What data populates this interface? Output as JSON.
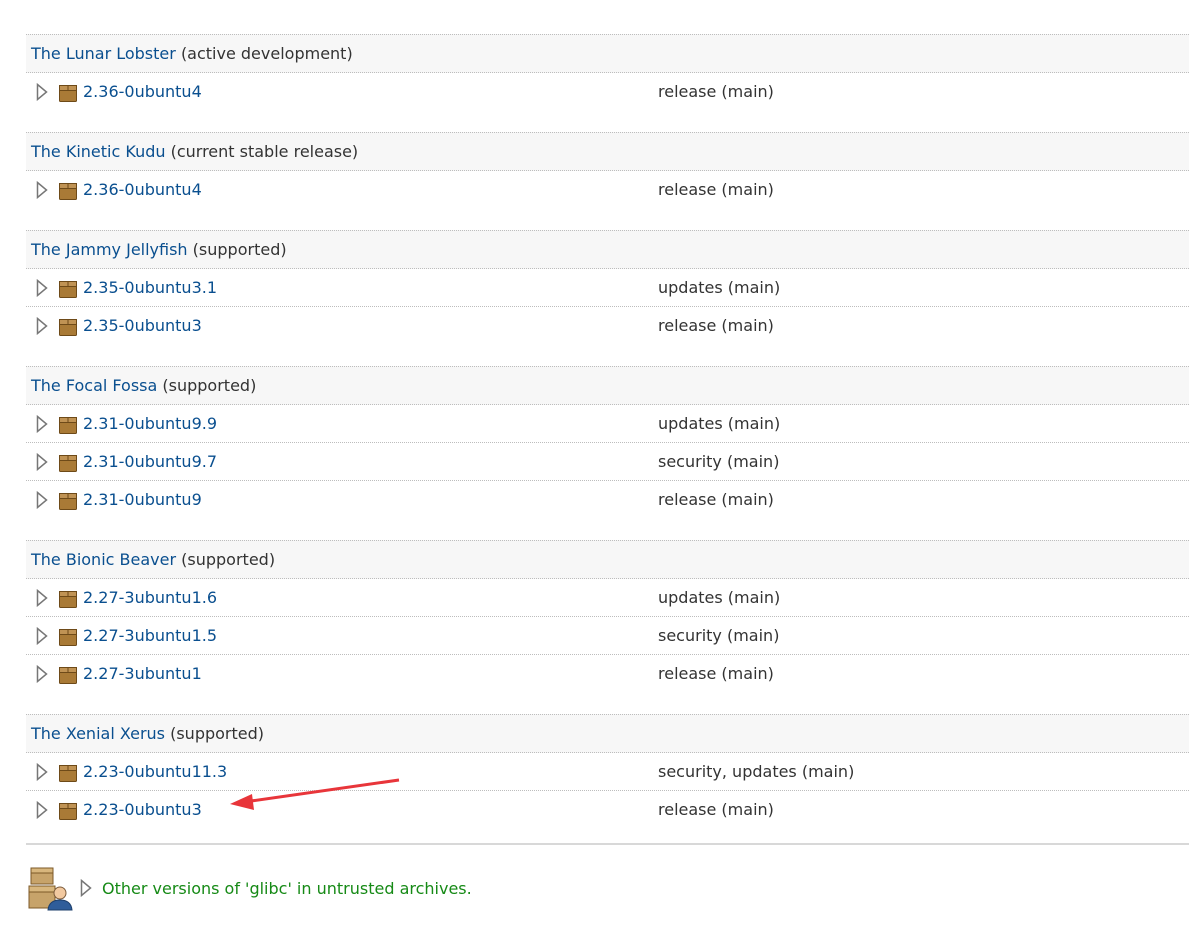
{
  "series": [
    {
      "name": "The Lunar Lobster",
      "status": "(active development)",
      "packages": [
        {
          "version": "2.36-0ubuntu4",
          "pocket": "release (main)"
        }
      ]
    },
    {
      "name": "The Kinetic Kudu",
      "status": "(current stable release)",
      "packages": [
        {
          "version": "2.36-0ubuntu4",
          "pocket": "release (main)"
        }
      ]
    },
    {
      "name": "The Jammy Jellyfish",
      "status": "(supported)",
      "packages": [
        {
          "version": "2.35-0ubuntu3.1",
          "pocket": "updates (main)"
        },
        {
          "version": "2.35-0ubuntu3",
          "pocket": "release (main)"
        }
      ]
    },
    {
      "name": "The Focal Fossa",
      "status": "(supported)",
      "packages": [
        {
          "version": "2.31-0ubuntu9.9",
          "pocket": "updates (main)"
        },
        {
          "version": "2.31-0ubuntu9.7",
          "pocket": "security (main)"
        },
        {
          "version": "2.31-0ubuntu9",
          "pocket": "release (main)"
        }
      ]
    },
    {
      "name": "The Bionic Beaver",
      "status": "(supported)",
      "packages": [
        {
          "version": "2.27-3ubuntu1.6",
          "pocket": "updates (main)"
        },
        {
          "version": "2.27-3ubuntu1.5",
          "pocket": "security (main)"
        },
        {
          "version": "2.27-3ubuntu1",
          "pocket": "release (main)"
        }
      ]
    },
    {
      "name": "The Xenial Xerus",
      "status": "(supported)",
      "packages": [
        {
          "version": "2.23-0ubuntu11.3",
          "pocket": "security, updates (main)"
        },
        {
          "version": "2.23-0ubuntu3",
          "pocket": "release (main)"
        }
      ]
    }
  ],
  "footer": {
    "untrusted_text": "Other versions of 'glibc' in untrusted archives."
  },
  "icons": {
    "expander": "triangle-right-icon",
    "package": "package-box-icon",
    "untrusted": "package-user-icon"
  },
  "colors": {
    "link": "#0a4f8f",
    "untrusted_link": "#168a16",
    "annotation_arrow": "#e8353a",
    "header_bg": "#f7f7f7",
    "package_box": "#9a6a2a"
  }
}
